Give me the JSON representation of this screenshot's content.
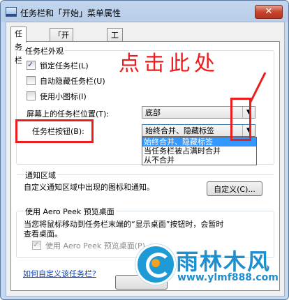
{
  "window": {
    "title": "任务栏和「开始」菜单属性",
    "close_glyph": "✕"
  },
  "tabs": [
    {
      "label": "任务栏",
      "active": true
    },
    {
      "label": "「开始」菜单",
      "active": false
    },
    {
      "label": "工具栏",
      "active": false
    }
  ],
  "appearance": {
    "legend": "任务栏外观",
    "checkboxes": [
      {
        "label": "锁定任务栏(L)",
        "checked": true
      },
      {
        "label": "自动隐藏任务栏(U)",
        "checked": false
      },
      {
        "label": "使用小图标(I)",
        "checked": false
      }
    ],
    "position_label": "屏幕上的任务栏位置(T):",
    "position_value": "底部",
    "buttons_label": "任务栏按钮(B):",
    "buttons_value": "始终合并、隐藏标签",
    "buttons_options": [
      "始终合并、隐藏标签",
      "当任务栏被占满时合并",
      "从不合并"
    ],
    "buttons_selected_index": 0
  },
  "notification": {
    "legend": "通知区域",
    "description": "自定义通知区域中出现的图标和通知。",
    "customize_button": "自定义(C)..."
  },
  "aero": {
    "legend": "使用 Aero Peek 预览桌面",
    "description_line1": "当您将鼠标移动到任务栏末端的“显示桌面”按钮时，会暂时",
    "description_line2": "查看桌面。",
    "checkbox_label": "使用 Aero Peek 预览桌面(P)",
    "checkbox_checked": true,
    "checkbox_disabled": true
  },
  "help_link": "如何自定义该任务栏?",
  "annotation": {
    "text": "点击此处",
    "color": "#ea1e1e"
  },
  "watermark": {
    "name": "雨林木风",
    "url": "www.ylmf888.com"
  }
}
